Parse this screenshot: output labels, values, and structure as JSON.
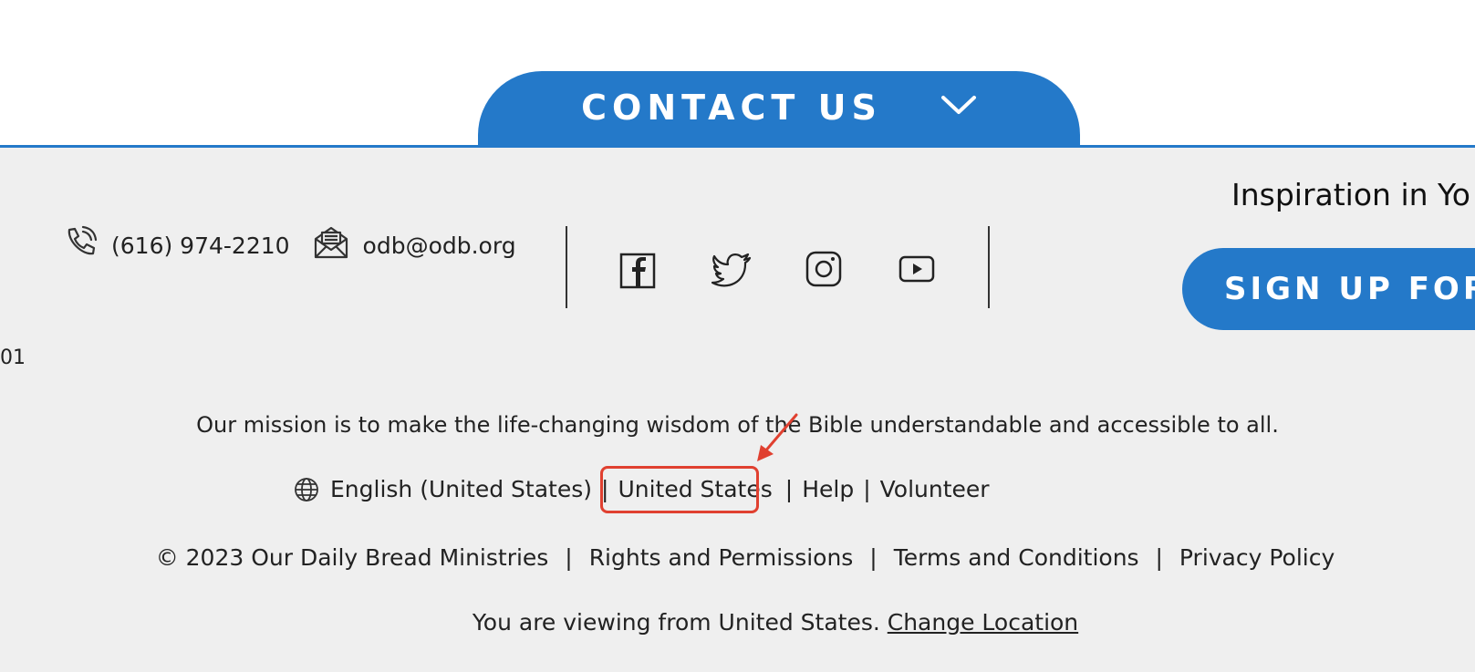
{
  "contact": {
    "tab_label": "CONTACT US",
    "phone": "(616) 974-2210",
    "email": "odb@odb.org"
  },
  "social": {
    "icons": [
      "facebook-icon",
      "twitter-icon",
      "instagram-icon",
      "youtube-icon"
    ]
  },
  "newsletter": {
    "title": "Inspiration in Yo",
    "button_label": "SIGN UP FOR"
  },
  "left_fragment": "01",
  "footer": {
    "mission": "Our mission is to make the life-changing wisdom of the Bible understandable and accessible to all.",
    "language": "English (United States)",
    "country": "United States",
    "help": "Help",
    "volunteer": "Volunteer",
    "copyright": "© 2023 Our Daily Bread Ministries",
    "rights": "Rights and Permissions",
    "terms": "Terms and Conditions",
    "privacy": "Privacy Policy",
    "viewing_text": "You are viewing from United States.",
    "change_location": "Change Location",
    "pipe": "|"
  },
  "colors": {
    "brand_blue": "#2479c9",
    "footer_bg": "#efefef",
    "annotation_red": "#e04030"
  }
}
